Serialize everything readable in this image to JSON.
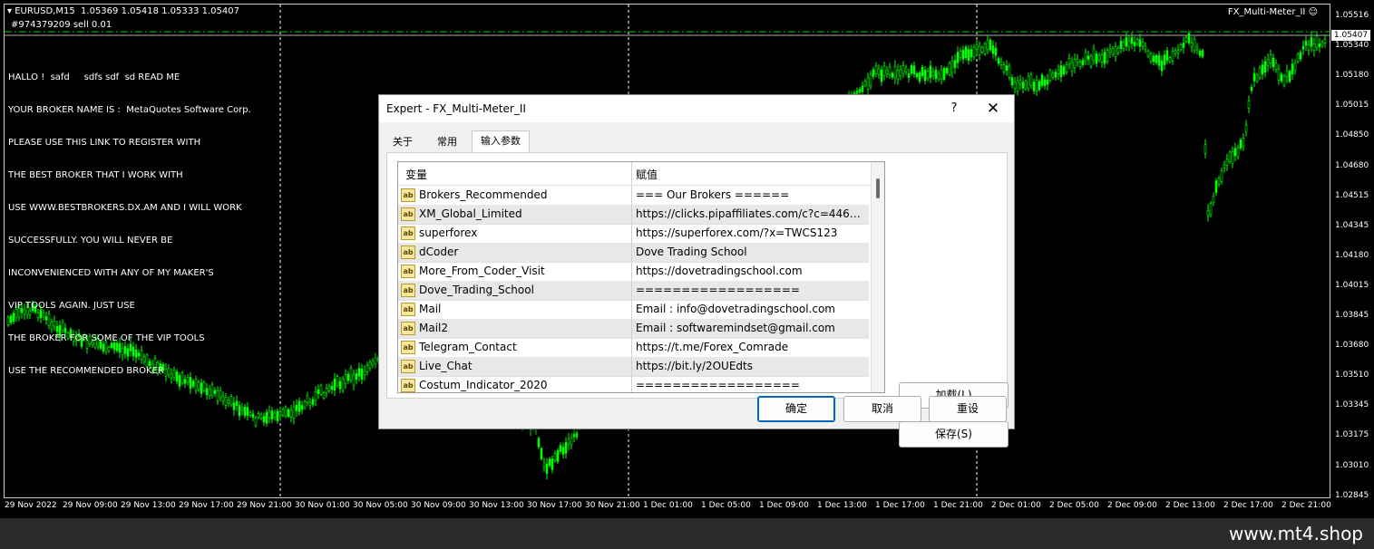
{
  "chart": {
    "symbol": "EURUSD,M15  1.05369 1.05418 1.05333 1.05407",
    "order_label": "#974379209 sell 0.01",
    "indicator_name": "FX_Multi-Meter_II",
    "current_price": "1.05407",
    "comment_lines": [
      "HALLO !  safd     sdfs sdf  sd READ ME",
      "YOUR BROKER NAME IS :  MetaQuotes Software Corp.",
      "PLEASE USE THIS LINK TO REGISTER WITH",
      "THE BEST BROKER THAT I WORK WITH",
      "USE WWW.BESTBROKERS.DX.AM AND I WILL WORK",
      "SUCCESSFULLY. YOU WILL NEVER BE",
      "INCONVENIENCED WITH ANY OF MY MAKER'S",
      "VIP TOOLS AGAIN. JUST USE",
      "THE BROKER FOR SOME OF THE VIP TOOLS",
      "USE THE RECOMMENDED BROKER"
    ],
    "price_ticks": [
      "1.05516",
      "1.05340",
      "1.05180",
      "1.05015",
      "1.04850",
      "1.04680",
      "1.04515",
      "1.04345",
      "1.04180",
      "1.04015",
      "1.03845",
      "1.03680",
      "1.03510",
      "1.03345",
      "1.03175",
      "1.03010",
      "1.02845"
    ],
    "time_ticks": [
      "29 Nov 2022",
      "29 Nov 09:00",
      "29 Nov 13:00",
      "29 Nov 17:00",
      "29 Nov 21:00",
      "30 Nov 01:00",
      "30 Nov 05:00",
      "30 Nov 09:00",
      "30 Nov 13:00",
      "30 Nov 17:00",
      "30 Nov 21:00",
      "1 Dec 01:00",
      "1 Dec 05:00",
      "1 Dec 09:00",
      "1 Dec 13:00",
      "1 Dec 17:00",
      "1 Dec 21:00",
      "2 Dec 01:00",
      "2 Dec 05:00",
      "2 Dec 09:00",
      "2 Dec 13:00",
      "2 Dec 17:00",
      "2 Dec 21:00"
    ],
    "colors": {
      "background": "#000000",
      "candles": "#00ff00",
      "grid": "#ffffff",
      "order_line": "#00c800"
    }
  },
  "dialog": {
    "title": "Expert - FX_Multi-Meter_II",
    "help_label": "?",
    "close_label": "✕",
    "tabs": [
      {
        "label": "关于"
      },
      {
        "label": "常用"
      },
      {
        "label": "输入参数"
      }
    ],
    "table": {
      "col_variable": "变量",
      "col_value": "赋值",
      "icon_text": "ab",
      "rows": [
        {
          "variable": "Brokers_Recommended",
          "value": "=== Our Brokers ======"
        },
        {
          "variable": "XM_Global_Limited",
          "value": "https://clicks.pipaffiliates.com/c?c=44626..."
        },
        {
          "variable": "superforex",
          "value": "https://superforex.com/?x=TWCS123"
        },
        {
          "variable": "dCoder",
          "value": "Dove Trading School"
        },
        {
          "variable": "More_From_Coder_Visit",
          "value": "https://dovetradingschool.com"
        },
        {
          "variable": "Dove_Trading_School",
          "value": "=================="
        },
        {
          "variable": "Mail",
          "value": "Email : info@dovetradingschool.com"
        },
        {
          "variable": "Mail2",
          "value": "Email : softwaremindset@gmail.com"
        },
        {
          "variable": "Telegram_Contact",
          "value": "https://t.me/Forex_Comrade"
        },
        {
          "variable": "Live_Chat",
          "value": "https://bit.ly/2OUEdts"
        },
        {
          "variable": "Costum_Indicator_2020",
          "value": "=================="
        }
      ]
    },
    "buttons": {
      "load": "加载(L)",
      "save": "保存(S)",
      "ok": "确定",
      "cancel": "取消",
      "reset": "重设"
    }
  },
  "footer": {
    "brand": "www.mt4.shop"
  }
}
